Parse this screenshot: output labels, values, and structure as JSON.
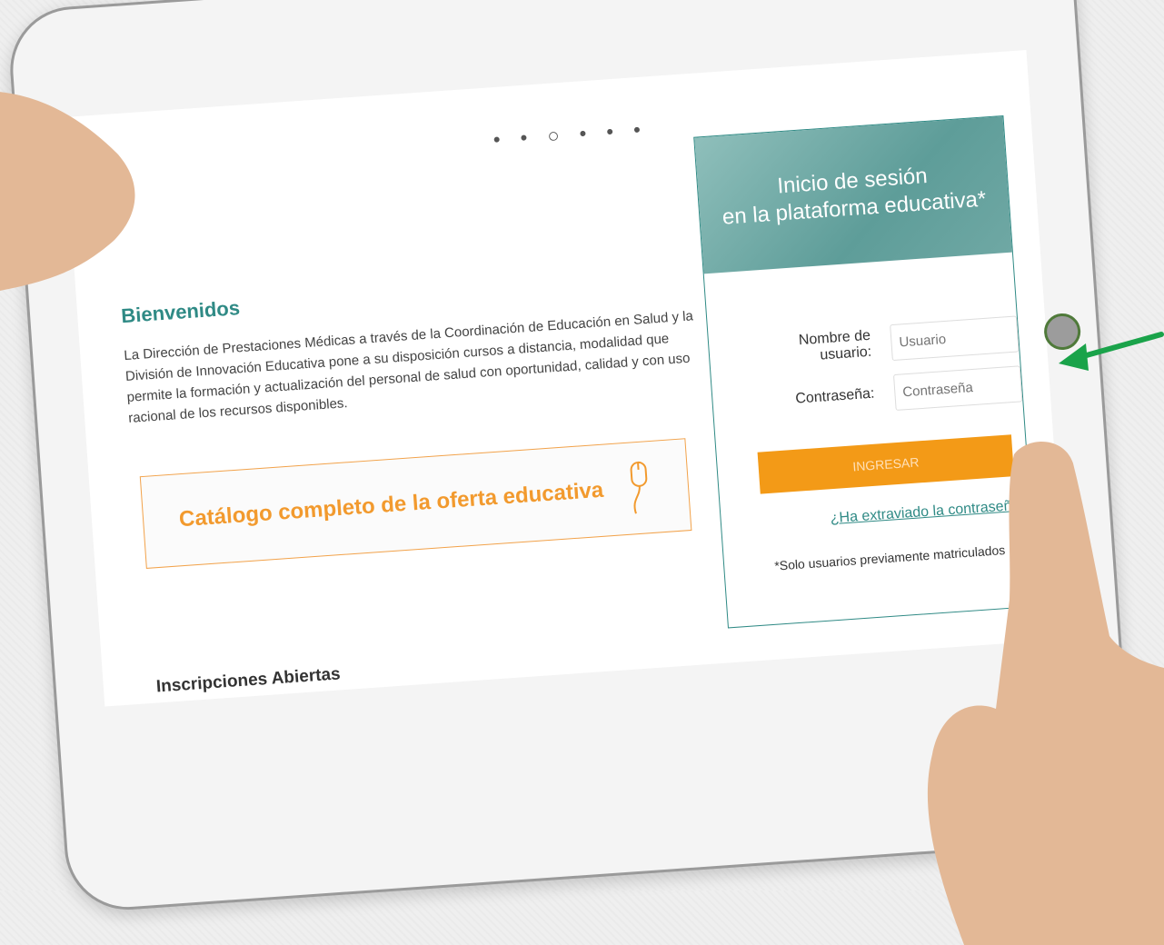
{
  "carousel": {
    "indicator": "• • ○ • • •"
  },
  "welcome": {
    "title": "Bienvenidos",
    "text": "La Dirección de Prestaciones Médicas a través de la Coordinación de Educación en Salud y la División de Innovación Educativa pone a su disposición cursos a distancia, modalidad que permite la formación y actualización del personal de salud con oportunidad, calidad y con uso racional de los recursos disponibles."
  },
  "catalog": {
    "label": "Catálogo completo de la oferta educativa",
    "icon": "mouse-icon"
  },
  "login": {
    "title_line1": "Inicio de sesión",
    "title_line2": "en la plataforma educativa*",
    "username_label": "Nombre de usuario:",
    "username_placeholder": "Usuario",
    "password_label": "Contraseña:",
    "password_placeholder": "Contraseña",
    "submit_label": "INGRESAR",
    "forgot_link": "¿Ha extraviado la contraseña?",
    "note": "*Solo usuarios previamente matriculados"
  },
  "sections": {
    "open_enrollments": "Inscripciones Abiertas"
  },
  "colors": {
    "accent": "#2f8a85",
    "orange": "#f39a17",
    "arrow": "#1aa34a"
  }
}
